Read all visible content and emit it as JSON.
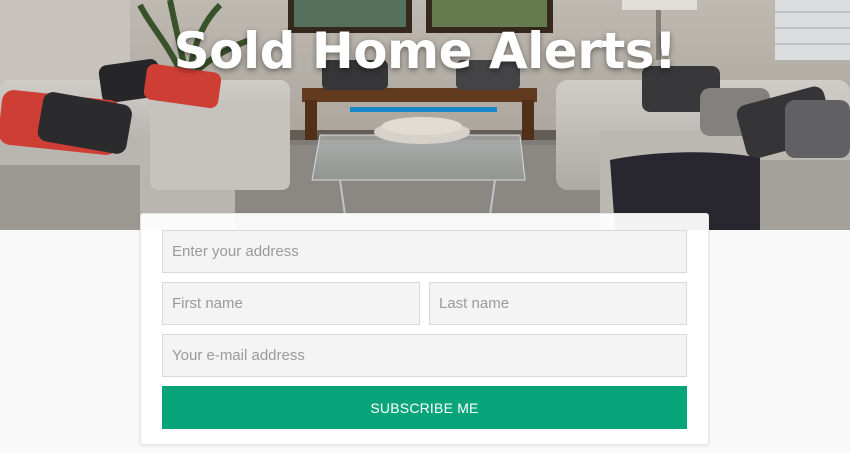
{
  "hero": {
    "title": "Sold Home Alerts!",
    "accent_color": "#1a87c9"
  },
  "form": {
    "address_placeholder": "Enter your address",
    "first_name_placeholder": "First name",
    "last_name_placeholder": "Last name",
    "email_placeholder": "Your e-mail address",
    "submit_label": "SUBSCRIBE ME",
    "submit_color": "#08a57a"
  }
}
